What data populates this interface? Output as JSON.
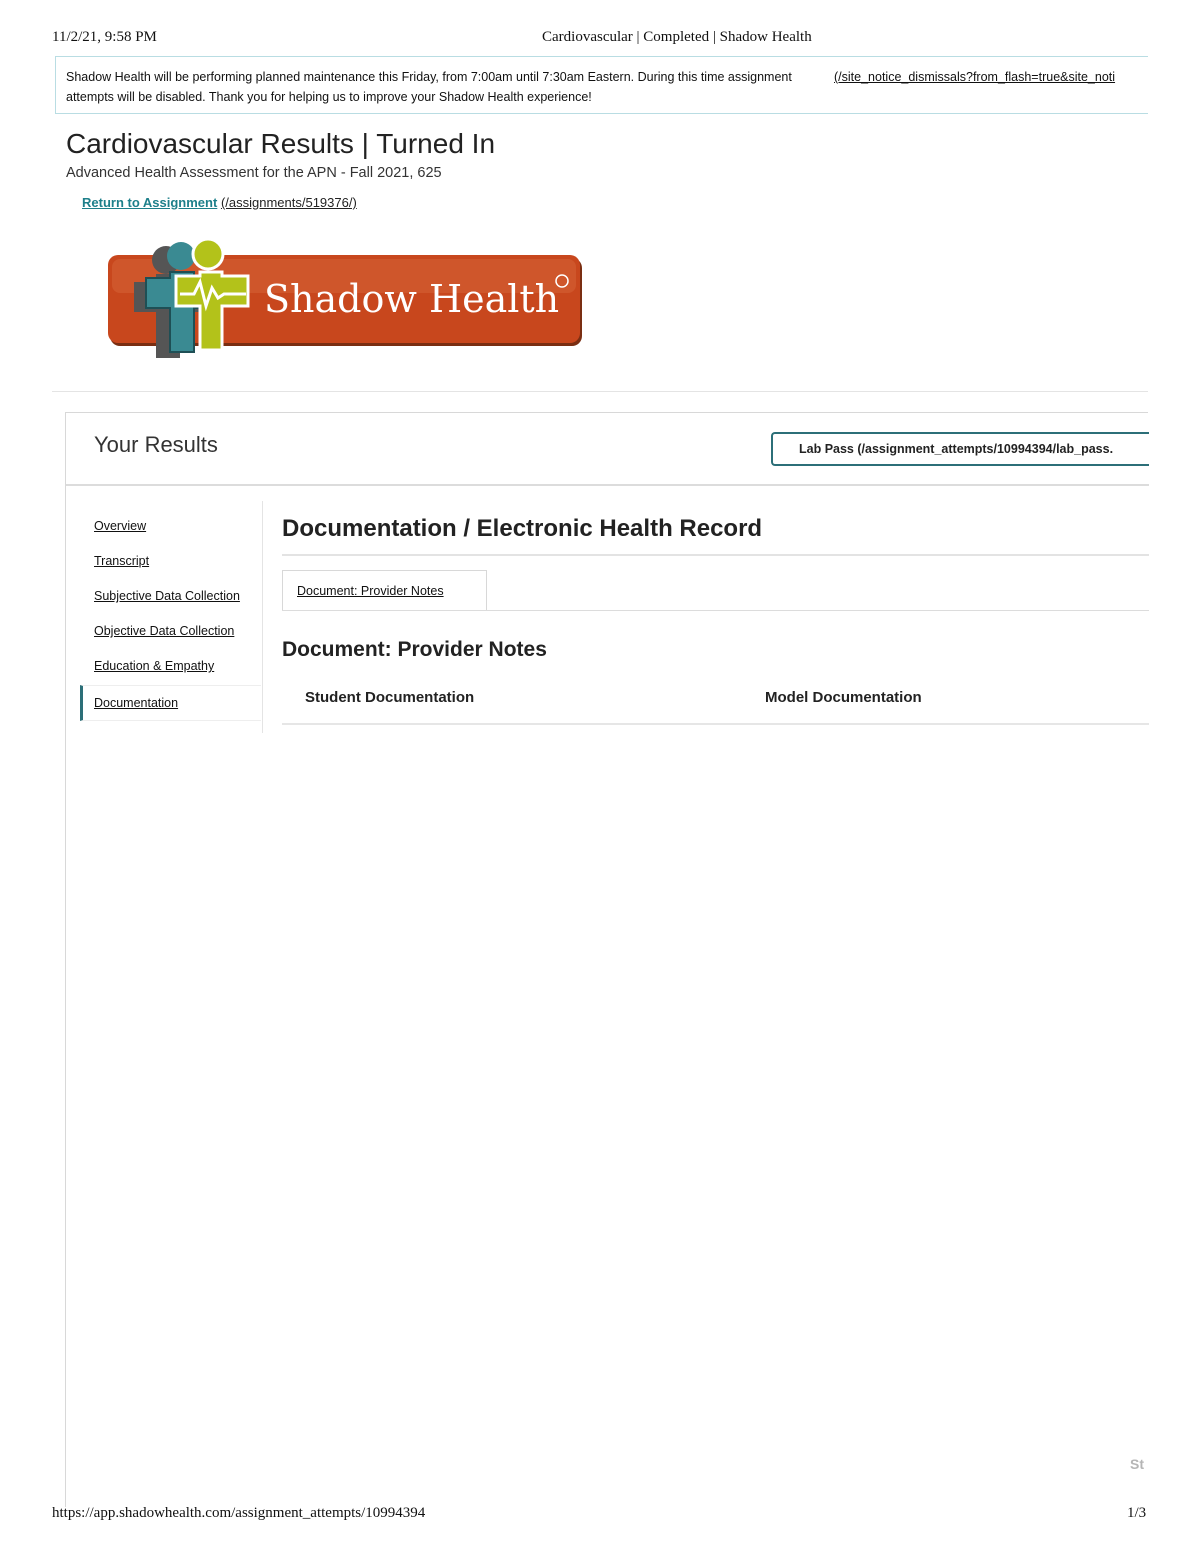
{
  "print_header": {
    "date": "11/2/21, 9:58 PM",
    "title": "Cardiovascular | Completed | Shadow Health"
  },
  "notice": {
    "text": "Shadow Health will be performing planned maintenance this Friday, from 7:00am until 7:30am Eastern. During this time assignment attempts will be disabled. Thank you for helping us to improve your Shadow Health experience!",
    "dismiss_link": "(/site_notice_dismissals?from_flash=true&site_noti"
  },
  "page": {
    "title": "Cardiovascular Results | Turned In",
    "subtitle": "Advanced Health Assessment for the APN - Fall 2021, 625",
    "return_label": "Return to Assignment",
    "return_path": "(/assignments/519376/)"
  },
  "logo": {
    "text": "Shadow Health",
    "brand_color": "#c8471d",
    "accent_teal": "#3a8a92",
    "accent_green": "#b3c21a"
  },
  "results": {
    "title": "Your Results",
    "lab_pass": "Lab Pass (/assignment_attempts/10994394/lab_pass."
  },
  "nav": {
    "items": [
      "Overview",
      "Transcript",
      "Subjective Data Collection",
      "Objective Data Collection",
      "Education & Empathy",
      "Documentation"
    ],
    "active": "Documentation"
  },
  "main": {
    "heading": "Documentation / Electronic Health Record",
    "tab_label": "Document: Provider Notes",
    "section_heading": "Document: Provider Notes",
    "col_student": "Student Documentation",
    "col_model": "Model Documentation"
  },
  "corner_fragment": "St",
  "print_footer": {
    "url": "https://app.shadowhealth.com/assignment_attempts/10994394",
    "page": "1/3"
  }
}
